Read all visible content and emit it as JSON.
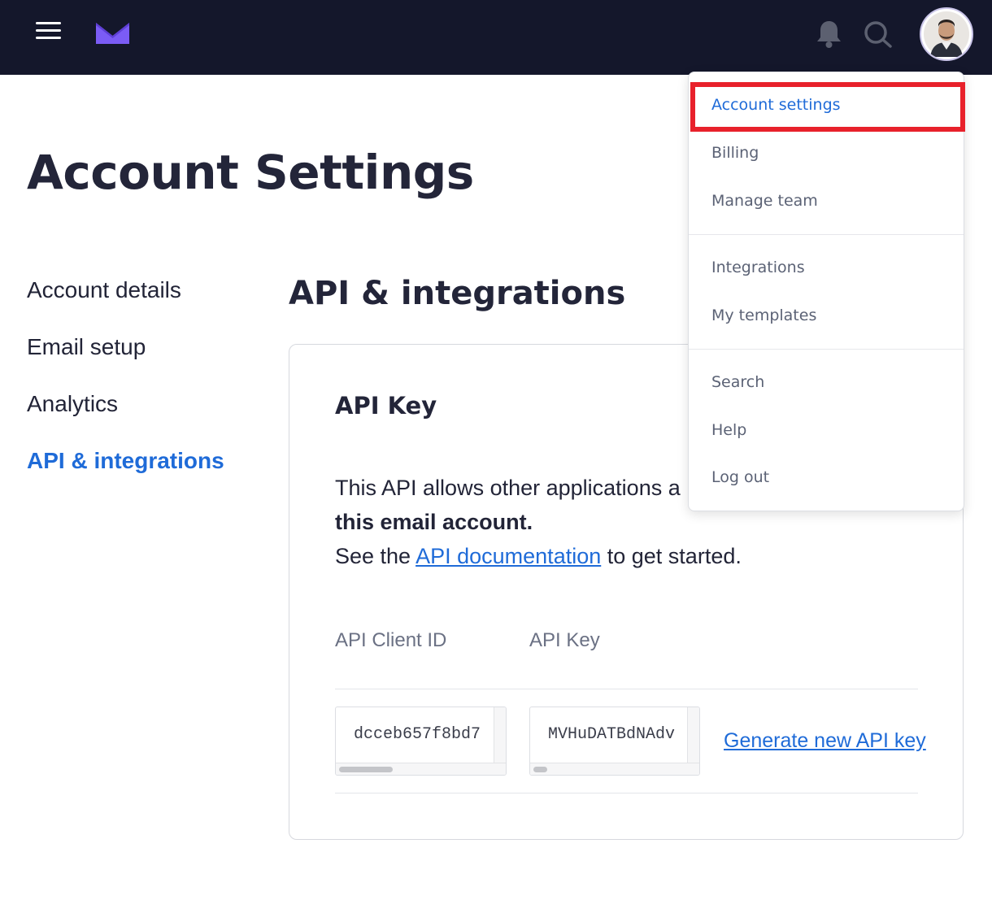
{
  "colors": {
    "topbar": "#14172b",
    "accent": "#1f6bd8",
    "logo": "#7b5cf5",
    "highlight": "#e8212b",
    "heading": "#232539"
  },
  "topbar": {
    "menu_icon": "hamburger-icon",
    "logo_icon": "envelope-logo-icon",
    "notifications_icon": "bell-icon",
    "search_icon": "search-icon",
    "avatar": "user-avatar"
  },
  "page": {
    "title": "Account Settings"
  },
  "sidebar": {
    "items": [
      {
        "label": "Account details",
        "active": false
      },
      {
        "label": "Email setup",
        "active": false
      },
      {
        "label": "Analytics",
        "active": false
      },
      {
        "label": "API & integrations",
        "active": true
      }
    ]
  },
  "main": {
    "section_title": "API & integrations",
    "card": {
      "title": "API Key",
      "desc_line1": "This API allows other applications a",
      "desc_bold": "this email account.",
      "desc_see": "See the ",
      "desc_link": "API documentation",
      "desc_after": " to get started.",
      "col_client_id": "API Client ID",
      "col_api_key": "API Key",
      "client_id_value": "dcceb657f8bd7",
      "api_key_value": "MVHuDATBdNAdv",
      "generate_link": "Generate new API key"
    }
  },
  "dropdown": {
    "items": [
      {
        "label": "Account settings",
        "active": true
      },
      {
        "label": "Billing",
        "active": false
      },
      {
        "label": "Manage team",
        "active": false
      },
      {
        "label": "Integrations",
        "active": false
      },
      {
        "label": "My templates",
        "active": false
      },
      {
        "label": "Search",
        "active": false
      },
      {
        "label": "Help",
        "active": false
      },
      {
        "label": "Log out",
        "active": false
      }
    ]
  }
}
